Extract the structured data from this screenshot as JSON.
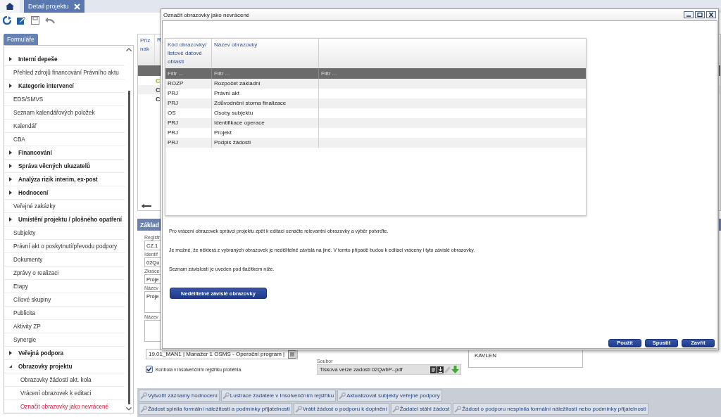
{
  "tabs": [
    {
      "label": "Detail projektu",
      "selected": true
    }
  ],
  "sidebar": {
    "title": "Formuláře",
    "items": [
      {
        "label": "Interní depeše",
        "kind": "group",
        "expanded": false
      },
      {
        "label": "Přehled zdrojů financování Právního aktu",
        "kind": "item",
        "selected": false
      },
      {
        "label": "Kategorie intervencí",
        "kind": "group",
        "expanded": false
      },
      {
        "label": "EDS/SMVS",
        "kind": "item",
        "selected": false
      },
      {
        "label": "Seznam kalendářových položek",
        "kind": "item",
        "selected": false
      },
      {
        "label": "Kalendář",
        "kind": "item",
        "selected": false
      },
      {
        "label": "CBA",
        "kind": "item",
        "selected": false
      },
      {
        "label": "Financování",
        "kind": "group",
        "expanded": false
      },
      {
        "label": "Správa věcných ukazatelů",
        "kind": "group",
        "expanded": false
      },
      {
        "label": "Analýza rizik interim, ex-post",
        "kind": "group",
        "expanded": false
      },
      {
        "label": "Hodnocení",
        "kind": "group",
        "expanded": false
      },
      {
        "label": "Veřejné zakázky",
        "kind": "item",
        "selected": false
      },
      {
        "label": "Umístění projektu / plošného opatření",
        "kind": "group",
        "expanded": false
      },
      {
        "label": "Subjekty",
        "kind": "item",
        "selected": false
      },
      {
        "label": "Právní akt o poskytnutí/převodu podpory",
        "kind": "item",
        "selected": false
      },
      {
        "label": "Dokumenty",
        "kind": "item",
        "selected": false
      },
      {
        "label": "Zprávy o realizaci",
        "kind": "item",
        "selected": false
      },
      {
        "label": "Etapy",
        "kind": "item",
        "selected": false
      },
      {
        "label": "Cílové skupiny",
        "kind": "item",
        "selected": false
      },
      {
        "label": "Publicita",
        "kind": "item",
        "selected": false
      },
      {
        "label": "Aktivity ZP",
        "kind": "item",
        "selected": false
      },
      {
        "label": "Synergie",
        "kind": "item",
        "selected": false
      },
      {
        "label": "Veřejná podpora",
        "kind": "group",
        "expanded": false
      },
      {
        "label": "Obrazovky projektu",
        "kind": "group",
        "expanded": true,
        "children": [
          {
            "label": "Obrazovky žádostí akt. kola",
            "selected": false
          },
          {
            "label": "Vrácení obrazovek k editaci",
            "selected": false
          },
          {
            "label": "Označit obrazovky jako nevrácené",
            "selected": true
          }
        ]
      }
    ]
  },
  "grid": {
    "columns": [
      "Příznak",
      "R"
    ],
    "rows": [
      {
        "cell": "C",
        "color": "#a0a82a"
      },
      {
        "cell": "C",
        "color": "#333333"
      },
      {
        "cell": "C",
        "color": "#333333"
      }
    ]
  },
  "detail": {
    "title": "Základ",
    "fields": [
      {
        "label": "Registr",
        "value": "CZ.1",
        "kind": "input"
      },
      {
        "label": "Identif",
        "value": "02Qu",
        "kind": "input"
      },
      {
        "label": "Zkráce",
        "value": "Proje",
        "kind": "input"
      },
      {
        "label": "Název",
        "value": "Proje",
        "kind": "textarea"
      },
      {
        "label": "Název",
        "kind": "textarea"
      }
    ]
  },
  "competence": {
    "value": "19.01_MAN1 | Manažer 1 OSMS - Operační program |"
  },
  "insolvency_check": {
    "label": "Kontrola v insolvenčním rejstříku proběhla.",
    "checked": true
  },
  "file": {
    "label": "Soubor",
    "value": "Tiskova verze zadosti 02QwbP-.pdf"
  },
  "side_box": {
    "value": "KAVLEN"
  },
  "action_rows": [
    [
      "Vytvořit záznamy hodnocení",
      "Lustrace žadatele v Insolvenčním rejstříku",
      "Aktualizovat subjekty veřejné podpory"
    ],
    [
      "Žádost splnila formální náležitosti a podmínky přijatelnosti",
      "Vrátit žádost o podporu k doplnění",
      "Žadatel stáhl žádost",
      "Žádost o podporu nesplnila formální náležitosti nebo podmínky přijatelnosti"
    ]
  ],
  "dialog": {
    "title": "Označit obrazovky jako nevrácené",
    "table": {
      "columns": [
        "Kód obrazovky/ listové datové oblasti",
        "Název obrazovky"
      ],
      "filters": [
        {
          "placeholder": "Filtr ..."
        },
        {
          "placeholder": "Filtr ..."
        },
        {
          "placeholder": "Filtr ..."
        }
      ],
      "rows": [
        {
          "code": "ROZP",
          "name": "Rozpočet základní"
        },
        {
          "code": "PRJ",
          "name": "Právní akt"
        },
        {
          "code": "PRJ",
          "name": "Zdůvodnění storna finalizace"
        },
        {
          "code": "OS",
          "name": "Osoby subjektu"
        },
        {
          "code": "PRJ",
          "name": "Identifikace operace"
        },
        {
          "code": "PRJ",
          "name": "Projekt"
        },
        {
          "code": "PRJ",
          "name": "Podpis žádosti"
        }
      ]
    },
    "paragraphs": [
      "Pro vrácení obrazovek správci projektu zpět k editaci označte relevantní obrazovky a výběr potvrďte.",
      "Je možné, že některá z vybraných obrazovek je nedělitelně závislá na jiné. V tomto případě budou k editaci vráceny i tyto závislé obrazovky.",
      "Seznam závislostí je uveden pod tlačítkem níže."
    ],
    "dependency_button": "Nedělitelně závislé obrazovky",
    "buttons": [
      "Použít",
      "Spustit",
      "Zavřít"
    ]
  }
}
